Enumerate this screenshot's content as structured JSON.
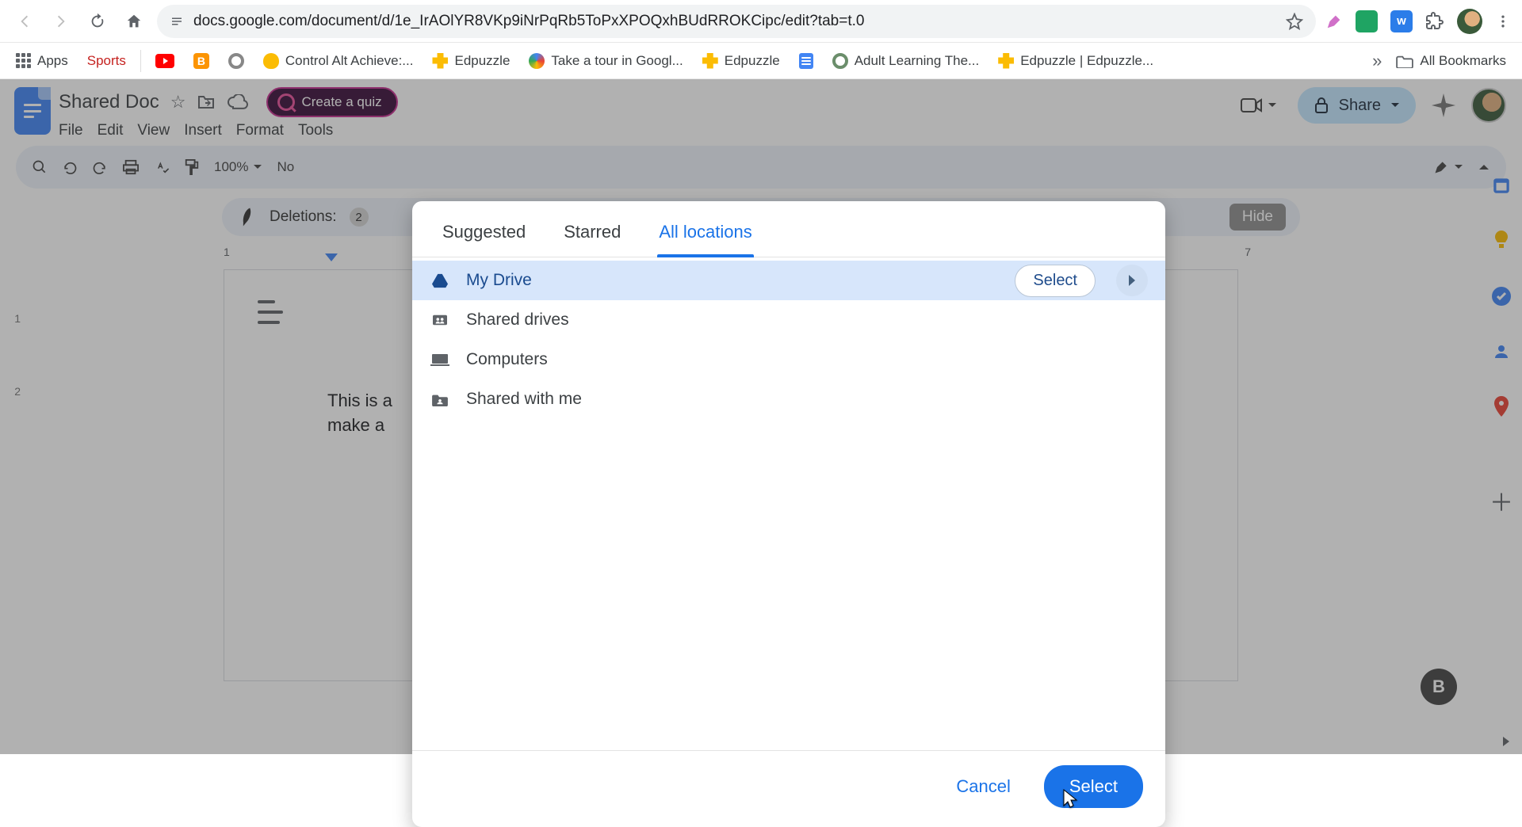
{
  "browser": {
    "url": "docs.google.com/document/d/1e_IrAOlYR8VKp9iNrPqRb5ToPxXPOQxhBUdRROKCipc/edit?tab=t.0"
  },
  "bookmarks": {
    "apps": "Apps",
    "sports": "Sports",
    "control_alt": "Control Alt Achieve:...",
    "edpuzzle_1": "Edpuzzle",
    "tour": "Take a tour in Googl...",
    "edpuzzle_2": "Edpuzzle",
    "adult_learning": "Adult Learning The...",
    "edpuzzle_3": "Edpuzzle | Edpuzzle...",
    "all_bookmarks": "All Bookmarks"
  },
  "docs": {
    "title": "Shared Doc",
    "menu": {
      "file": "File",
      "edit": "Edit",
      "view": "View",
      "insert": "Insert",
      "format": "Format",
      "tools": "Tools"
    },
    "quiz_pill": "Create a quiz",
    "share": "Share",
    "zoom": "100%",
    "normal_text": "No",
    "deletions_label": "Deletions:",
    "deletions_count": "2",
    "hide_label": "Hide",
    "ruler_1": "1",
    "ruler_7": "7",
    "vruler_1": "1",
    "vruler_2": "2",
    "body_line1": "This is a",
    "body_line2": "make a"
  },
  "dialog": {
    "tabs": {
      "suggested": "Suggested",
      "starred": "Starred",
      "all": "All locations"
    },
    "locations": {
      "my_drive": "My Drive",
      "shared_drives": "Shared drives",
      "computers": "Computers",
      "shared_with_me": "Shared with me"
    },
    "row_select": "Select",
    "cancel": "Cancel",
    "select": "Select"
  }
}
